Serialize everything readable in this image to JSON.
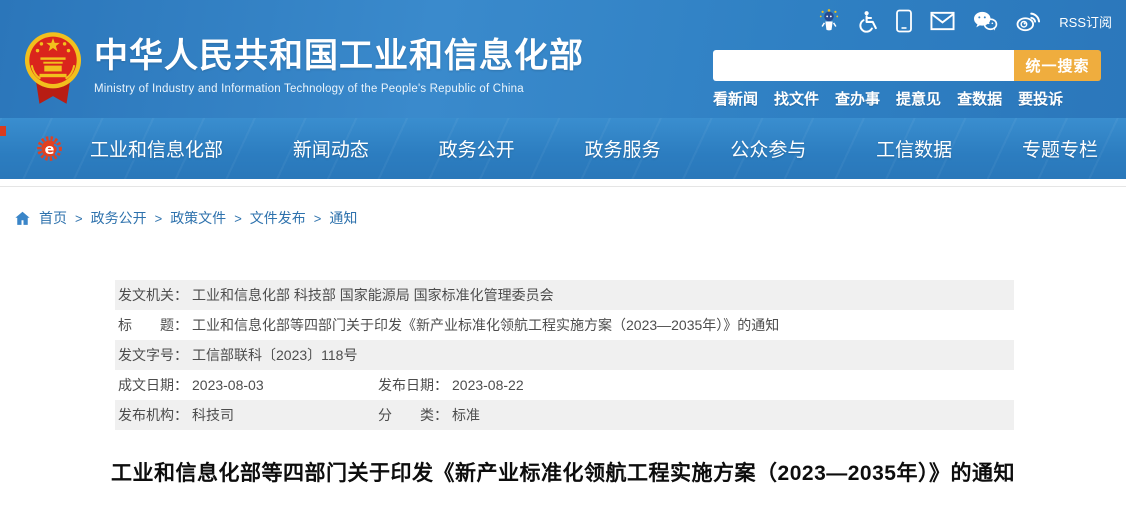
{
  "header": {
    "site_title": "中华人民共和国工业和信息化部",
    "site_subtitle": "Ministry of Industry and Information Technology of the People's Republic of China",
    "rss_label": "RSS订阅",
    "utility_icon_names": [
      "ai-mascot-icon",
      "accessibility-icon",
      "mobile-icon",
      "mail-icon",
      "wechat-icon",
      "weibo-icon"
    ],
    "search": {
      "button_label": "统一搜索",
      "input_value": ""
    },
    "quick_links": [
      "看新闻",
      "找文件",
      "查办事",
      "提意见",
      "查数据",
      "要投诉"
    ]
  },
  "nav": {
    "items": [
      "工业和信息化部",
      "新闻动态",
      "政务公开",
      "政务服务",
      "公众参与",
      "工信数据",
      "专题专栏"
    ]
  },
  "breadcrumb": {
    "separator": ">",
    "items": [
      "首页",
      "政务公开",
      "政策文件",
      "文件发布",
      "通知"
    ]
  },
  "doc_meta": {
    "rows": [
      {
        "cells": [
          {
            "label": "发文机关：",
            "value": "工业和信息化部 科技部 国家能源局 国家标准化管理委员会"
          }
        ]
      },
      {
        "cells": [
          {
            "label": "标　　题：",
            "value": "工业和信息化部等四部门关于印发《新产业标准化领航工程实施方案（2023—2035年）》的通知"
          }
        ]
      },
      {
        "cells": [
          {
            "label": "发文字号：",
            "value": "工信部联科〔2023〕118号"
          }
        ]
      },
      {
        "cells": [
          {
            "label": "成文日期：",
            "value": "2023-08-03"
          },
          {
            "label": "发布日期：",
            "value": "2023-08-22"
          }
        ]
      },
      {
        "cells": [
          {
            "label": "发布机构：",
            "value": "科技司"
          },
          {
            "label": "分　　类：",
            "value": "标准"
          }
        ]
      }
    ]
  },
  "article": {
    "title": "工业和信息化部等四部门关于印发《新产业标准化领航工程实施方案（2023—2035年）》的通知"
  },
  "colors": {
    "header_blue": "#2f80c3",
    "accent_gold": "#efad3e",
    "breadcrumb_blue": "#2e72ad",
    "row_gray": "#f0f0f0",
    "emblem_red": "#da251c",
    "emblem_gold": "#f2c01d"
  }
}
